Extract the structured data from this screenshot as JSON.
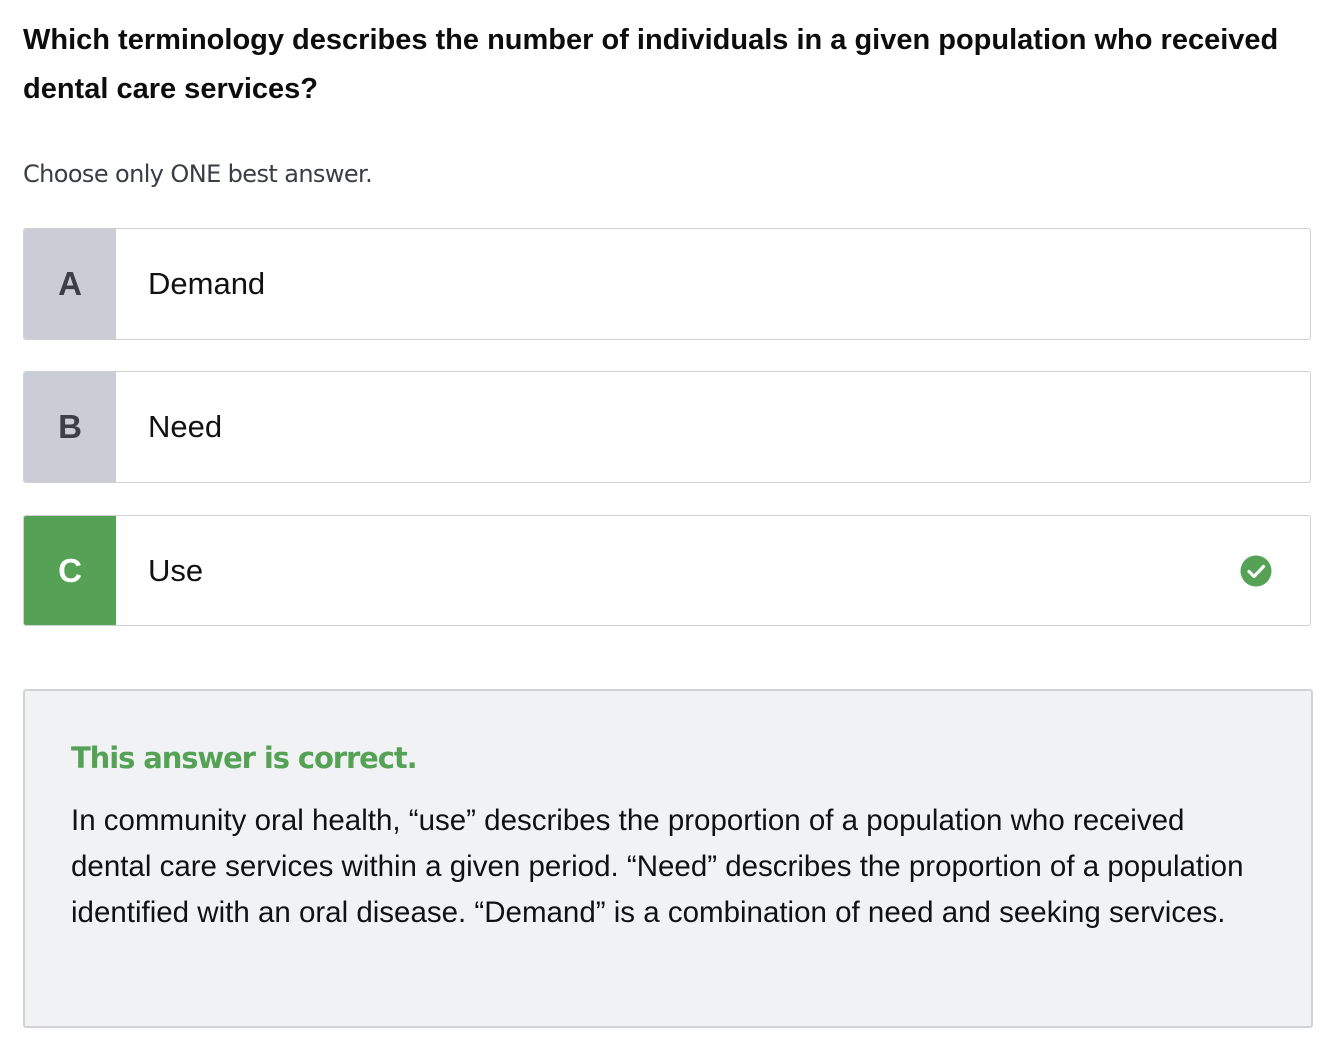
{
  "question": {
    "text": "Which terminology describes the number of individuals in a given population who received dental care services?",
    "instruction": "Choose only ONE best answer."
  },
  "options": [
    {
      "letter": "A",
      "text": "Demand",
      "state": "unselected"
    },
    {
      "letter": "B",
      "text": "Need",
      "state": "unselected"
    },
    {
      "letter": "C",
      "text": "Use",
      "state": "correct",
      "icon": "checkmark-circle-icon"
    }
  ],
  "feedback": {
    "title": "This answer is correct.",
    "body": "In community oral health, “use” describes the proportion of a population who received dental care services within a given period. “Need” describes the proportion of a population identified with an oral disease. “Demand” is a combination of need and seeking services."
  },
  "colors": {
    "correct_green": "#55a257",
    "letter_gray": "#cbcdd6",
    "feedback_bg": "#f1f2f4",
    "border": "#cfd1d6"
  }
}
